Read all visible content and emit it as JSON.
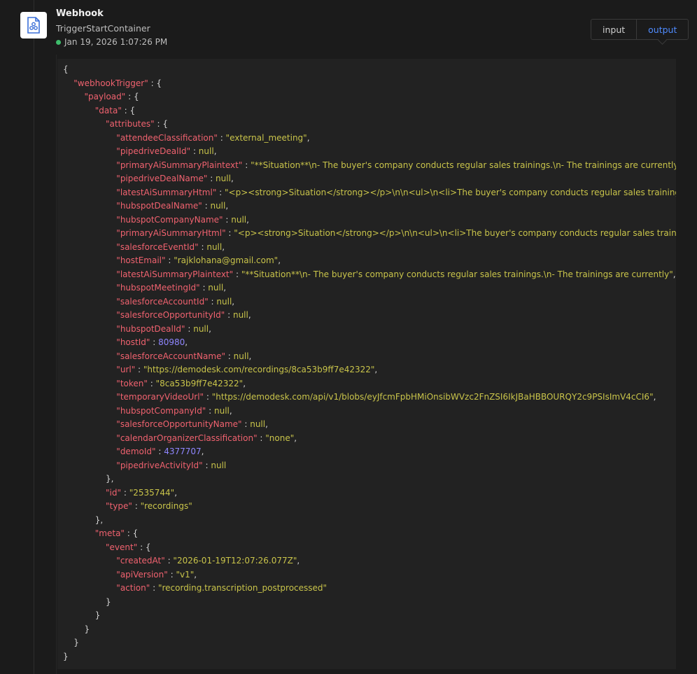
{
  "header": {
    "title": "Webhook",
    "subtitle": "TriggerStartContainer",
    "timestamp": "Jan 19, 2026 1:07:26 PM",
    "status_color": "#3ebd6b"
  },
  "tabs": [
    {
      "label": "input",
      "active": false
    },
    {
      "label": "output",
      "active": true
    }
  ],
  "icons": {
    "node": "webhook-icon"
  },
  "colors": {
    "accent": "#4f8bff",
    "key": "#f0626f",
    "string": "#c9c44a",
    "number": "#8f86ff"
  },
  "output": {
    "webhookTrigger": {
      "payload": {
        "data": {
          "attributes": {
            "attendeeClassification": "external_meeting",
            "pipedriveDealId": null,
            "primaryAiSummaryPlaintext": "**Situation**\\n- The buyer's company conducts regular sales trainings.\\n- The trainings are currently",
            "pipedriveDealName": null,
            "latestAiSummaryHtml": "<p><strong>Situation</strong></p>\\n\\n<ul>\\n<li>The buyer's company conducts regular sales trainings",
            "hubspotDealName": null,
            "hubspotCompanyName": null,
            "primaryAiSummaryHtml": "<p><strong>Situation</strong></p>\\n\\n<ul>\\n<li>The buyer's company conducts regular sales trainings",
            "salesforceEventId": null,
            "hostEmail": "rajklohana@gmail.com",
            "latestAiSummaryPlaintext": "**Situation**\\n- The buyer's company conducts regular sales trainings.\\n- The trainings are currently",
            "hubspotMeetingId": null,
            "salesforceAccountId": null,
            "salesforceOpportunityId": null,
            "hubspotDealId": null,
            "hostId": 80980,
            "salesforceAccountName": null,
            "url": "https://demodesk.com/recordings/8ca53b9ff7e42322",
            "token": "8ca53b9ff7e42322",
            "temporaryVideoUrl": "https://demodesk.com/api/v1/blobs/eyJfcmFpbHMiOnsibWVzc2FnZSI6IkJBaHBBOURQY2c9PSIsImV4cCI6",
            "hubspotCompanyId": null,
            "salesforceOpportunityName": null,
            "calendarOrganizerClassification": "none",
            "demoId": 4377707,
            "pipedriveActivityId": null
          },
          "id": "2535744",
          "type": "recordings"
        },
        "meta": {
          "event": {
            "createdAt": "2026-01-19T12:07:26.077Z",
            "apiVersion": "v1",
            "action": "recording.transcription_postprocessed"
          }
        }
      }
    }
  }
}
